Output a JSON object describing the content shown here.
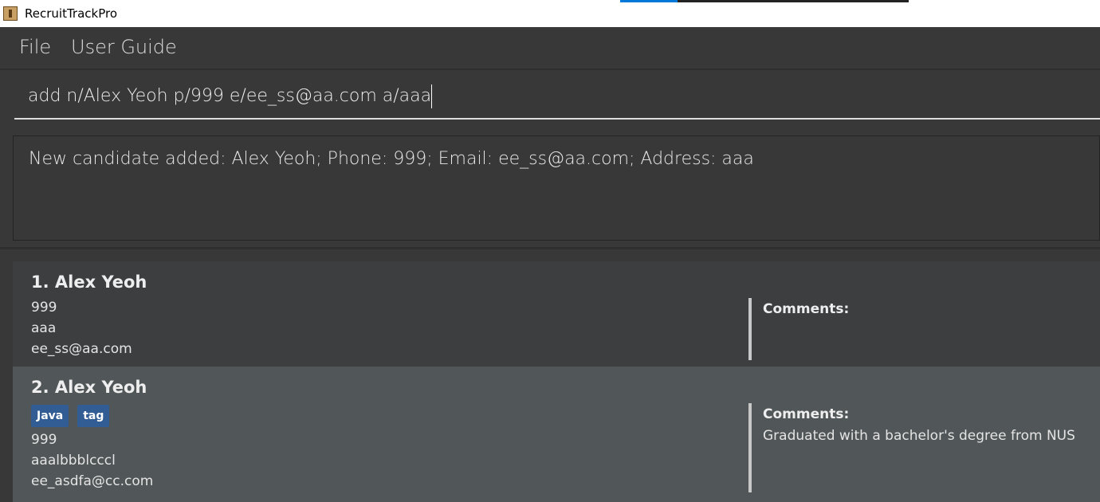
{
  "window": {
    "title": "RecruitTrackPro"
  },
  "menu": {
    "file": "File",
    "user_guide": "User Guide"
  },
  "command_box": {
    "value": "add n/Alex  Yeoh p/999 e/ee_ss@aa.com a/aaa"
  },
  "result_display": {
    "text": "New candidate added: Alex  Yeoh; Phone: 999; Email: ee_ss@aa.com; Address: aaa"
  },
  "candidates": [
    {
      "name": "1. Alex  Yeoh",
      "tags": [],
      "phone": "999",
      "address": "aaa",
      "email": "ee_ss@aa.com",
      "comments_label": "Comments:",
      "comments": ""
    },
    {
      "name": "2. Alex Yeoh",
      "tags": [
        "Java",
        "tag"
      ],
      "phone": "999",
      "address": "aaalbbblcccl",
      "email": "ee_asdfa@cc.com",
      "comments_label": "Comments:",
      "comments": "Graduated with a bachelor's degree from NUS"
    }
  ],
  "colors": {
    "tag": "#325d94",
    "card_selected": "#515658",
    "card": "#3c3e40"
  }
}
